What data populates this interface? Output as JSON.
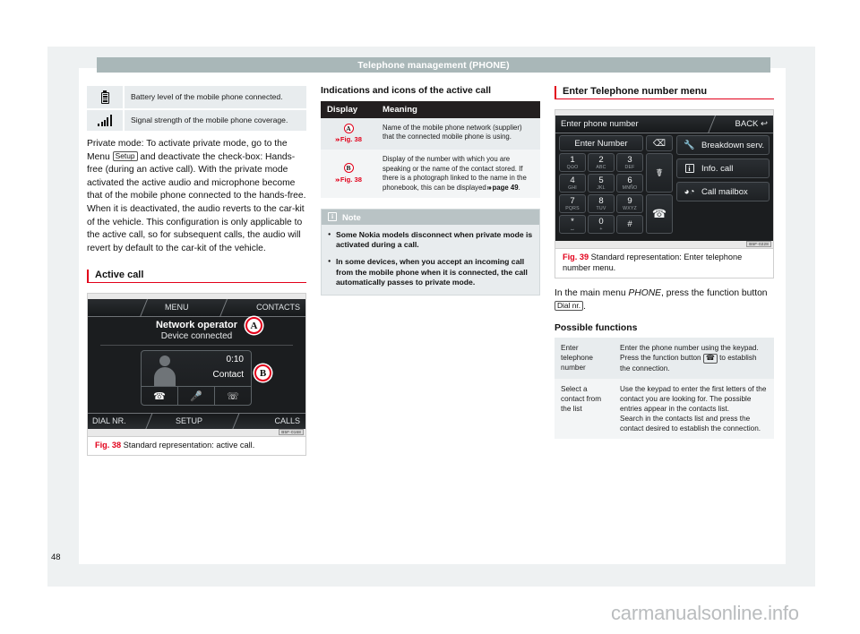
{
  "header": {
    "title": "Telephone management (PHONE)"
  },
  "folio": {
    "page_number": "48"
  },
  "watermark": {
    "text": "carmanualsonline.info"
  },
  "left_column": {
    "legend": [
      {
        "icon": "battery-icon",
        "text": "Battery level of the mobile phone connected."
      },
      {
        "icon": "signal-strength-icon",
        "text": "Signal strength of the mobile phone coverage."
      }
    ],
    "paragraph": {
      "before_kbd": "Private mode: To activate private mode, go to the Menu ",
      "kbd": "Setup",
      "after_kbd": " and deactivate the check-box: Hands-free (during an active call). With the private mode activated the active audio and microphone become that of the mobile phone connected to the hands-free. When it is deactivated, the audio reverts to the car-kit of the vehicle. This configuration is only applicable to the active call, so for subsequent calls, the audio will revert by default to the car-kit of the vehicle."
    },
    "section_heading": "Active call",
    "figure": {
      "code": "B5F-0168",
      "caption_label": "Fig. 38",
      "caption_text": "Standard representation: active call.",
      "screen": {
        "top_menu": "MENU",
        "top_contacts": "CONTACTS",
        "operator": "Network operator",
        "device_status": "Device connected",
        "timer": "0:10",
        "contact": "Contact",
        "call_buttons": [
          "answer-call-icon",
          "mute-microphone-icon",
          "end-call-icon"
        ],
        "bottom_dial": "DIAL NR.",
        "bottom_setup": "SETUP",
        "bottom_calls": "CALLS",
        "callout_a": "A",
        "callout_b": "B"
      }
    }
  },
  "middle_column": {
    "heading": "Indications and icons of the active call",
    "table": {
      "columns": [
        "Display",
        "Meaning"
      ],
      "rows": [
        {
          "ref_letter": "A",
          "ref_link": "Fig. 38",
          "meaning": "Name of the mobile phone network (supplier) that the connected mobile phone is using."
        },
        {
          "ref_letter": "B",
          "ref_link": "Fig. 38",
          "meaning_part1": "Display of the number with which you are speaking or the name of the contact stored. If there is a photograph linked to the name in the phonebook, this can be displayed",
          "meaning_link": "page 49",
          "meaning_part2": "."
        }
      ]
    },
    "note": {
      "title": "Note",
      "items": [
        "Some Nokia models disconnect when private mode is activated during a call.",
        "In some devices, when you accept an incoming call from the mobile phone when it is connected, the call automatically passes to private mode."
      ]
    }
  },
  "right_column": {
    "section_heading": "Enter Telephone number menu",
    "figure": {
      "code": "B5F-0228",
      "caption_label": "Fig. 39",
      "caption_text": "Standard representation: Enter telephone number menu.",
      "screen": {
        "title": "Enter phone number",
        "back": "BACK",
        "number_field": "Enter Number",
        "delete_icon": "backspace-icon",
        "keys": [
          {
            "num": "1",
            "sub": "QΩO"
          },
          {
            "num": "2",
            "sub": "ABC"
          },
          {
            "num": "3",
            "sub": "DEF"
          },
          {
            "num": "4",
            "sub": "GHI"
          },
          {
            "num": "5",
            "sub": "JKL"
          },
          {
            "num": "6",
            "sub": "MNÑO"
          },
          {
            "num": "7",
            "sub": "PQRS"
          },
          {
            "num": "8",
            "sub": "TUV"
          },
          {
            "num": "9",
            "sub": "WXYZ"
          },
          {
            "num": "*",
            "sub": "⌴"
          },
          {
            "num": "0",
            "sub": "+"
          },
          {
            "num": "#",
            "sub": ""
          }
        ],
        "headset_key": "headset-icon",
        "call_key": "call-handset-icon",
        "side_buttons": [
          {
            "icon": "breakdown-service-icon",
            "label": "Breakdown serv."
          },
          {
            "icon": "info-icon",
            "label": "Info. call"
          },
          {
            "icon": "mailbox-icon",
            "label": "Call mailbox"
          }
        ]
      }
    },
    "intro": {
      "part1": "In the main menu ",
      "emphasis": "PHONE",
      "part2": ", press the function button ",
      "button": "Dial nr.",
      "part3": "."
    },
    "functions_heading": "Possible functions",
    "functions": [
      {
        "key": "Enter telephone number",
        "desc_part1": "Enter the phone number using the keypad.",
        "desc_part2_before": "Press the function button ",
        "desc_button_icon": "call-handset-icon",
        "desc_part2_after": " to establish the connection."
      },
      {
        "key": "Select a contact from the list",
        "desc_part1": "Use the keypad to enter the first letters of the contact you are looking for. The possible entries appear in the contacts list.",
        "desc_part2": "Search in the contacts list and press the contact desired to establish the connection."
      }
    ]
  }
}
